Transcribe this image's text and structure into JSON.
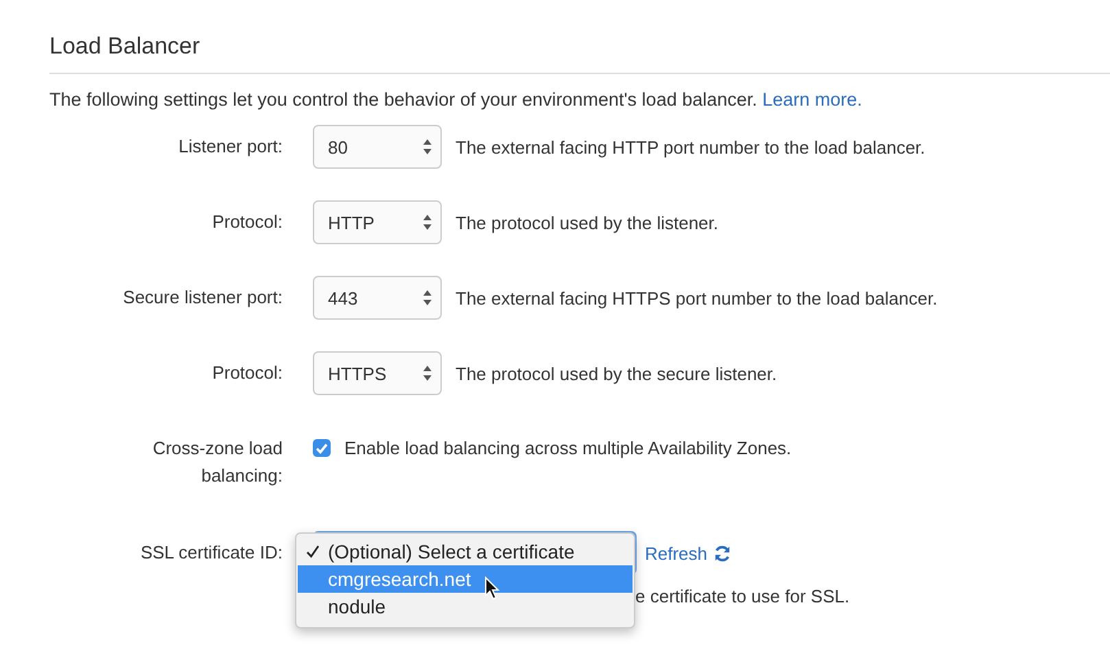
{
  "section": {
    "title": "Load Balancer",
    "description": "The following settings let you control the behavior of your environment's load balancer.",
    "link": "Learn more."
  },
  "fields": [
    {
      "kind": "select",
      "label": "Listener port:",
      "value": "80",
      "help": "The external facing HTTP port number to the load balancer."
    },
    {
      "kind": "select",
      "label": "Protocol:",
      "value": "HTTP",
      "help": "The protocol used by the listener."
    },
    {
      "kind": "select",
      "label": "Secure listener port:",
      "value": "443",
      "help": "The external facing HTTPS port number to the load balancer."
    },
    {
      "kind": "select",
      "label": "Protocol:",
      "value": "HTTPS",
      "help": "The protocol used by the secure listener."
    },
    {
      "kind": "checkbox",
      "label": "Cross-zone load balancing:",
      "checked": true,
      "text": "Enable load balancing across multiple Availability Zones."
    }
  ],
  "ssl": {
    "label": "SSL certificate ID:",
    "refresh": "Refresh",
    "help": "e certificate to use for SSL.",
    "options": [
      {
        "label": "(Optional) Select a certificate",
        "selected": true,
        "highlighted": false
      },
      {
        "label": "cmgresearch.net",
        "selected": false,
        "highlighted": true
      },
      {
        "label": "nodule",
        "selected": false,
        "highlighted": false
      }
    ]
  }
}
